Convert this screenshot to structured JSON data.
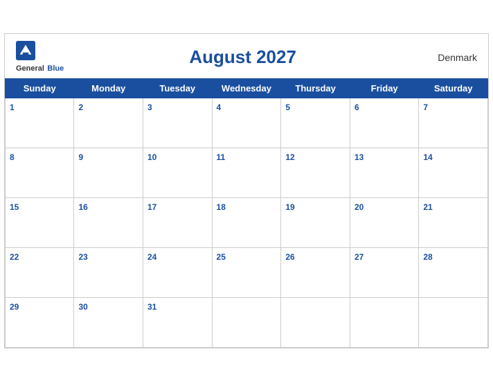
{
  "header": {
    "brand_general": "General",
    "brand_blue": "Blue",
    "title": "August 2027",
    "country": "Denmark"
  },
  "weekdays": [
    "Sunday",
    "Monday",
    "Tuesday",
    "Wednesday",
    "Thursday",
    "Friday",
    "Saturday"
  ],
  "weeks": [
    [
      1,
      2,
      3,
      4,
      5,
      6,
      7
    ],
    [
      8,
      9,
      10,
      11,
      12,
      13,
      14
    ],
    [
      15,
      16,
      17,
      18,
      19,
      20,
      21
    ],
    [
      22,
      23,
      24,
      25,
      26,
      27,
      28
    ],
    [
      29,
      30,
      31,
      null,
      null,
      null,
      null
    ]
  ]
}
